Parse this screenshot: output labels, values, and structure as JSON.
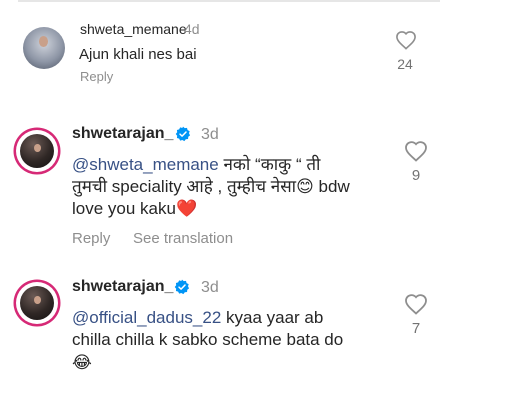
{
  "comments": [
    {
      "username": "shweta_memane",
      "time": "4d",
      "verified": false,
      "mention": "",
      "text": "Ajun khali nes bai",
      "actions": [
        "Reply"
      ],
      "likes": "24"
    },
    {
      "username": "shwetarajan_",
      "time": "3d",
      "verified": true,
      "mention": "@shweta_memane",
      "line1_text": " नको “काकु “ ती",
      "line2_text": "तुमची speciality आहे , तुम्हीच नेसा",
      "line2_emoji": "😊",
      "line2_tail": " bdw",
      "line3_text": "love you kaku",
      "line3_emoji": "❤️",
      "actions": [
        "Reply",
        "See translation"
      ],
      "likes": "9"
    },
    {
      "username": "shwetarajan_",
      "time": "3d",
      "verified": true,
      "mention": "@official_dadus_22",
      "line1_text": " kyaa yaar ab",
      "line2_text": "chilla chilla k sabko scheme bata do",
      "line3_emoji": "😂",
      "actions": [],
      "likes": "7"
    }
  ],
  "icons": {
    "like": "heart-outline-icon",
    "verified": "verified-badge-icon"
  },
  "colors": {
    "mention": "#385185",
    "verified": "#0095f6",
    "muted": "#8e8e8e",
    "heart_emoji": "#e0245e",
    "story_ring": "#d62976"
  }
}
